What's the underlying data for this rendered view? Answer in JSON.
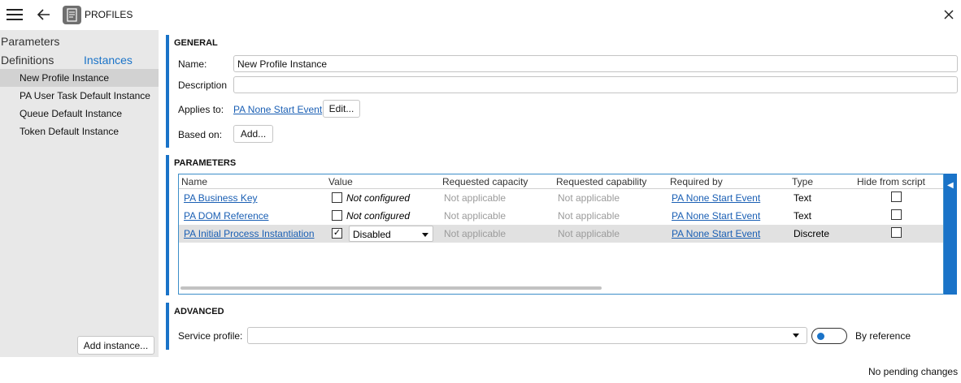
{
  "app": {
    "title": "PROFILES"
  },
  "sidebar": {
    "parameters_label": "Parameters",
    "definitions_label": "Definitions",
    "instances_label": "Instances",
    "items": [
      {
        "label": "New Profile Instance",
        "selected": true
      },
      {
        "label": "PA User Task Default Instance",
        "selected": false
      },
      {
        "label": "Queue Default Instance",
        "selected": false
      },
      {
        "label": "Token Default Instance",
        "selected": false
      }
    ],
    "add_button": "Add instance..."
  },
  "general": {
    "title": "GENERAL",
    "name_label": "Name:",
    "name_value": "New Profile Instance",
    "description_label": "Description",
    "description_value": "",
    "applies_to_label": "Applies to:",
    "applies_to_link": "PA None Start Event",
    "edit_button": "Edit...",
    "based_on_label": "Based on:",
    "add_button": "Add..."
  },
  "parameters": {
    "title": "PARAMETERS",
    "columns": [
      "Name",
      "Value",
      "Requested capacity",
      "Requested capability",
      "Required by",
      "Type",
      "Hide from script"
    ],
    "rows": [
      {
        "name": "PA Business Key",
        "checked": false,
        "value": "Not configured",
        "capacity": "Not applicable",
        "capability": "Not applicable",
        "required_by": "PA None Start Event",
        "type": "Text",
        "hide": false,
        "selected": false
      },
      {
        "name": "PA DOM Reference",
        "checked": false,
        "value": "Not configured",
        "capacity": "Not applicable",
        "capability": "Not applicable",
        "required_by": "PA None Start Event",
        "type": "Text",
        "hide": false,
        "selected": false
      },
      {
        "name": "PA Initial Process Instantiation",
        "checked": true,
        "value": "Disabled",
        "capacity": "Not applicable",
        "capability": "Not applicable",
        "required_by": "PA None Start Event",
        "type": "Discrete",
        "hide": false,
        "selected": true
      }
    ]
  },
  "advanced": {
    "title": "ADVANCED",
    "service_profile_label": "Service profile:",
    "service_profile_value": "",
    "by_reference_label": "By reference"
  },
  "status": {
    "text": "No pending changes"
  },
  "colors": {
    "accent": "#1a73c8",
    "link": "#1a5fb4",
    "sidebar_bg": "#e8e8e8"
  }
}
